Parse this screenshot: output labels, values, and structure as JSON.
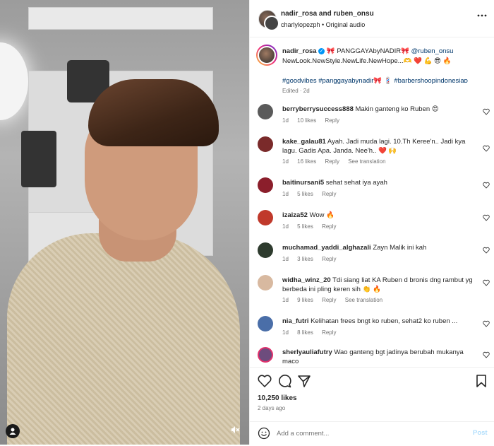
{
  "header": {
    "title": "nadir_rosa and ruben_onsu",
    "subtitle": "charlylopezph • Original audio"
  },
  "caption": {
    "username": "nadir_rosa",
    "verified_icon": "✓",
    "line1": "🎀 PANGGAYAbyNADIR🎀",
    "mention": "@ruben_onsu",
    "line2": "NewLook.NewStyle.NewLife.NewHope...🫶 ❤️ 💪 😎 🔥",
    "hashtags1": "#goodvibes #panggayabynadir🎀",
    "hashtags_sep": "💈",
    "hashtags2": "#barbershoopindonesiaᴅ",
    "edited": "Edited · 2d"
  },
  "comments": [
    {
      "user": "berryberrysuccess888",
      "text": "Makin ganteng ko Ruben 😍",
      "age": "1d",
      "likes": "10 likes",
      "reply": "Reply",
      "translate": "",
      "avatar_color": "#5a5a5a"
    },
    {
      "user": "kake_galau81",
      "text": "Ayah. Jadi muda lagi. 10.Th Keree'n.. Jadi kya lagu. Gadis Apa. Janda. Nee'h.. ❤️ 🙌",
      "age": "1d",
      "likes": "16 likes",
      "reply": "Reply",
      "translate": "See translation",
      "avatar_color": "#7a2a2a"
    },
    {
      "user": "baitinursani5",
      "text": "sehat sehat iya ayah",
      "age": "1d",
      "likes": "5 likes",
      "reply": "Reply",
      "translate": "",
      "avatar_color": "#8b1e2b"
    },
    {
      "user": "izaiza52",
      "text": "Wow 🔥",
      "age": "1d",
      "likes": "5 likes",
      "reply": "Reply",
      "translate": "",
      "avatar_color": "#c0392b"
    },
    {
      "user": "muchamad_yaddi_alghazali",
      "text": "Zayn Malik ini kah",
      "age": "1d",
      "likes": "3 likes",
      "reply": "Reply",
      "translate": "",
      "avatar_color": "#2e3b2e"
    },
    {
      "user": "widha_winz_20",
      "text": "Tdi siang liat KA Ruben d bronis dng rambut yg berbeda ini pling keren sih 👏 🔥",
      "age": "1d",
      "likes": "9 likes",
      "reply": "Reply",
      "translate": "See translation",
      "avatar_color": "#d8b9a0"
    },
    {
      "user": "nia_futri",
      "text": "Kelihatan frees bngt ko ruben, sehat2 ko ruben ...",
      "age": "1d",
      "likes": "8 likes",
      "reply": "Reply",
      "translate": "",
      "avatar_color": "#4a6ea8"
    },
    {
      "user": "sherlyauliafutry",
      "text": "Wao ganteng bgt jadinya berubah mukanya maco",
      "age": "",
      "likes": "",
      "reply": "",
      "translate": "",
      "avatar_color": "#6d4c7d"
    }
  ],
  "footer": {
    "likes": "10,250 likes",
    "ago": "2 days ago",
    "add_comment_placeholder": "Add a comment...",
    "post_label": "Post"
  },
  "colors": {
    "link": "#00376b",
    "muted": "#737373",
    "post_disabled": "#b2dffc",
    "verified": "#0095f6"
  }
}
